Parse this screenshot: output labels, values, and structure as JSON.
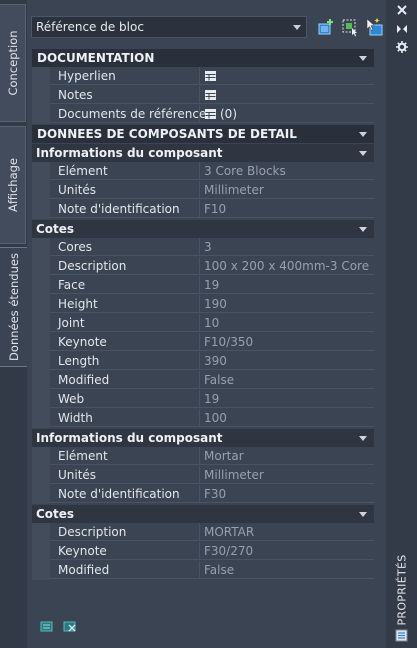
{
  "left_tabs": [
    "Conception",
    "Affichage",
    "Données étendues"
  ],
  "selector": {
    "value": "Référence de bloc"
  },
  "toolbar": [
    "quick-select-icon",
    "select-objects-icon",
    "toggle-pickadd-icon"
  ],
  "window_controls": [
    "close-icon",
    "auto-hide-icon",
    "properties-menu-icon"
  ],
  "palette_title": "PROPRIÉTÉS",
  "sections": {
    "documentation": {
      "title": "DOCUMENTATION",
      "rows": [
        {
          "label": "Hyperlien",
          "value": "",
          "icon": "table-icon"
        },
        {
          "label": "Notes",
          "value": "",
          "icon": "table-icon"
        },
        {
          "label": "Documents de référence",
          "value": "(0)",
          "icon": "table-icon"
        }
      ]
    },
    "detail": {
      "title": "DONNEES DE COMPOSANTS DE DETAIL",
      "groups": [
        {
          "title": "Informations du composant",
          "rows": [
            {
              "label": "Elément",
              "value": "3 Core Blocks"
            },
            {
              "label": "Unités",
              "value": "Millimeter"
            },
            {
              "label": "Note d'identification",
              "value": "F10"
            }
          ]
        },
        {
          "title": "Cotes",
          "rows": [
            {
              "label": "Cores",
              "value": "3"
            },
            {
              "label": "Description",
              "value": "100 x 200 x 400mm-3 Core"
            },
            {
              "label": "Face",
              "value": "19"
            },
            {
              "label": "Height",
              "value": "190"
            },
            {
              "label": "Joint",
              "value": "10"
            },
            {
              "label": "Keynote",
              "value": "F10/350"
            },
            {
              "label": "Length",
              "value": "390"
            },
            {
              "label": "Modified",
              "value": "False"
            },
            {
              "label": "Web",
              "value": "19"
            },
            {
              "label": "Width",
              "value": "100"
            }
          ]
        },
        {
          "title": "Informations du composant",
          "rows": [
            {
              "label": "Elément",
              "value": "Mortar"
            },
            {
              "label": "Unités",
              "value": "Millimeter"
            },
            {
              "label": "Note d'identification",
              "value": "F30"
            }
          ]
        },
        {
          "title": "Cotes",
          "rows": [
            {
              "label": "Description",
              "value": "MORTAR"
            },
            {
              "label": "Keynote",
              "value": "F30/270"
            },
            {
              "label": "Modified",
              "value": "False"
            }
          ]
        }
      ]
    }
  },
  "bottom_icons": [
    "add-data-icon",
    "remove-data-icon"
  ]
}
